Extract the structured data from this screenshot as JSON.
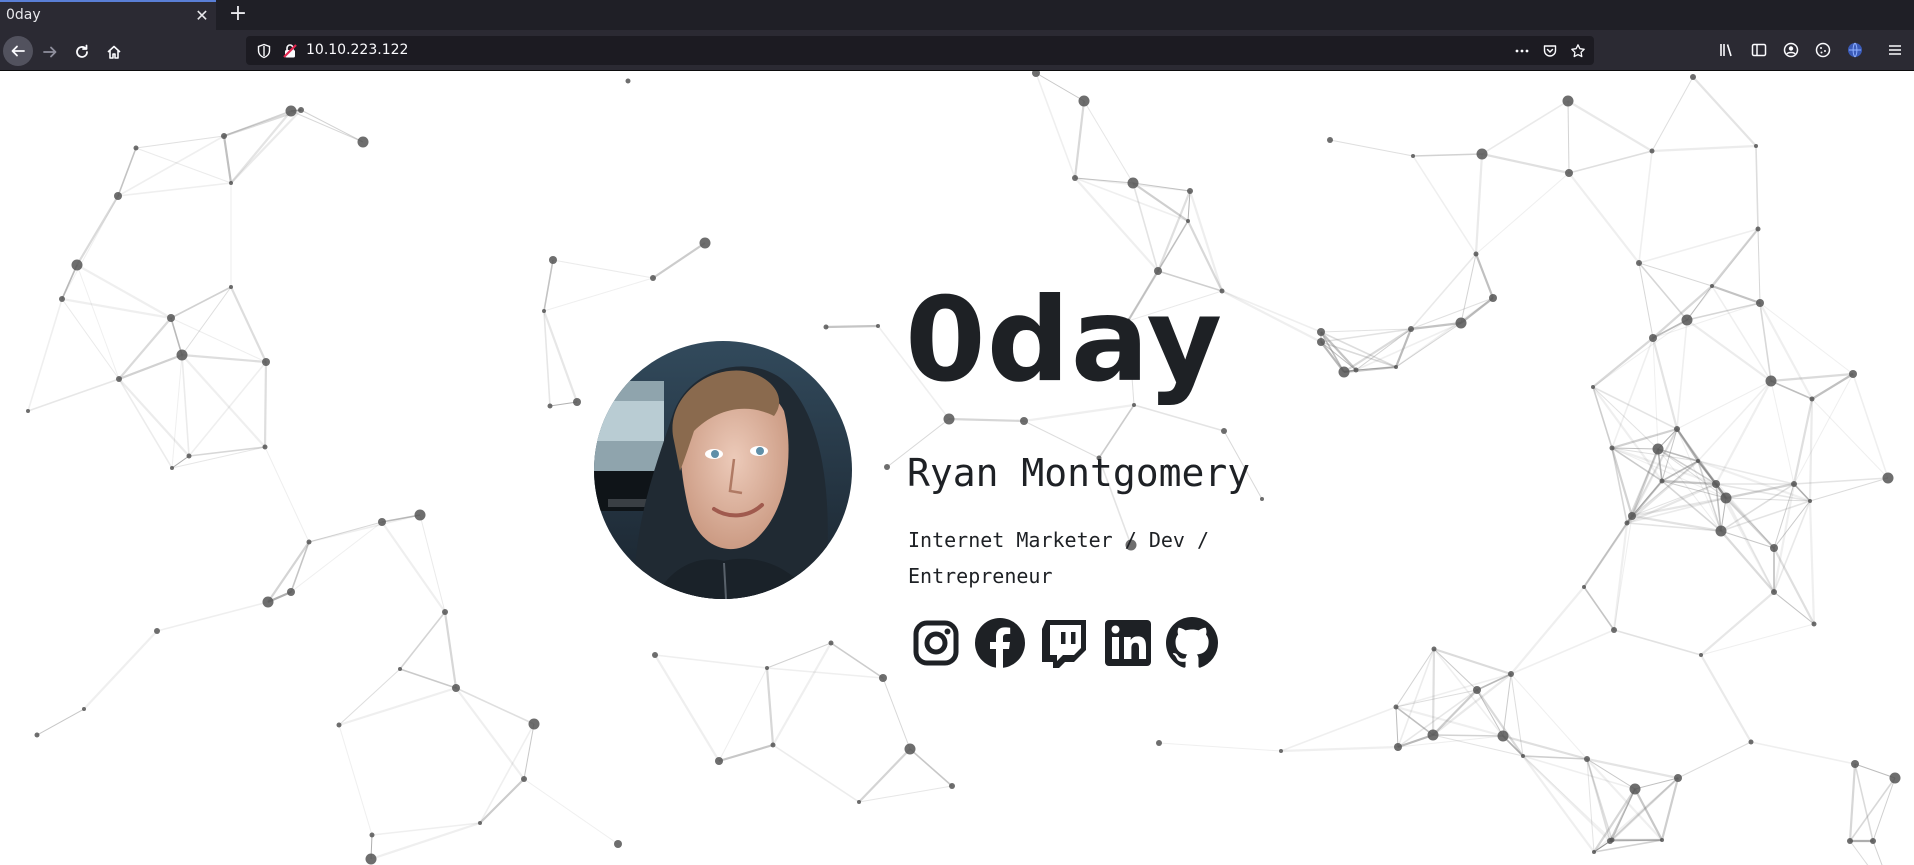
{
  "browser": {
    "tab_title": "0day",
    "tab_close": "✕",
    "new_tab": "+",
    "url": "10.10.223.122"
  },
  "profile": {
    "site_title": "0day",
    "name": "Ryan Montgomery",
    "role": "Internet Marketer / Dev / Entrepreneur",
    "photo_alt": "Profile photo of Ryan Montgomery"
  },
  "socials": [
    {
      "name": "Instagram",
      "icon": "instagram-icon"
    },
    {
      "name": "Facebook",
      "icon": "facebook-icon"
    },
    {
      "name": "Twitch",
      "icon": "twitch-icon"
    },
    {
      "name": "LinkedIn",
      "icon": "linkedin-icon"
    },
    {
      "name": "GitHub",
      "icon": "github-icon"
    }
  ],
  "colors": {
    "chrome_dark": "#1f1f26",
    "chrome": "#2b2a33",
    "text_dark": "#1e2125",
    "network_line": "#9a9a9a",
    "network_dot": "#555555"
  }
}
